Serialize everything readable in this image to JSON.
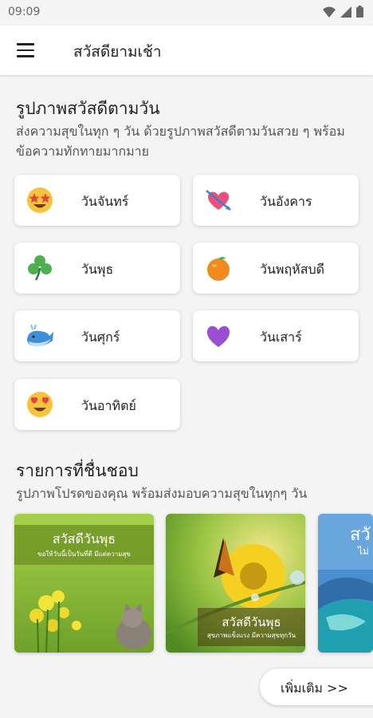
{
  "status": {
    "time": "09:09"
  },
  "appbar": {
    "title": "สวัสดียามเช้า"
  },
  "days_section": {
    "title": "รูปภาพสวัสดีตามวัน",
    "subtitle": "ส่งความสุขในทุก ๆ วัน ด้วยรูปภาพสวัสดีตามวันสวย ๆ พร้อมข้อความทักทายมากมาย",
    "items": [
      {
        "label": "วันจันทร์",
        "icon": "star-struck-face-icon"
      },
      {
        "label": "วันอังคาร",
        "icon": "heart-with-arrow-icon"
      },
      {
        "label": "วันพุธ",
        "icon": "shamrock-icon"
      },
      {
        "label": "วันพฤหัสบดี",
        "icon": "orange-icon"
      },
      {
        "label": "วันศุกร์",
        "icon": "whale-icon"
      },
      {
        "label": "วันเสาร์",
        "icon": "purple-heart-icon"
      },
      {
        "label": "วันอาทิตย์",
        "icon": "heart-eyes-face-icon"
      }
    ]
  },
  "favorites_section": {
    "title": "รายการที่ชื่นชอบ",
    "subtitle": "รูปภาพโปรดของคุณ พร้อมส่งมอบความสุขในทุกๆ วัน",
    "cards": [
      {
        "caption": "สวัสดีวันพุธ",
        "subcaption": "ขอให้วันนี้เป็นวันที่ดี มีแต่ความสุข"
      },
      {
        "caption": "สวัสดีวันพุธ",
        "subcaption": "สุขภาพแข็งแรง มีความสุขทุกวัน"
      },
      {
        "caption": "สวั",
        "subcaption": "ไม่"
      }
    ],
    "more_label": "เพิ่มเติม >>"
  },
  "colors": {
    "appbar_bg": "#ffffff",
    "page_bg": "#f4f4f4",
    "card_bg": "#ffffff"
  }
}
